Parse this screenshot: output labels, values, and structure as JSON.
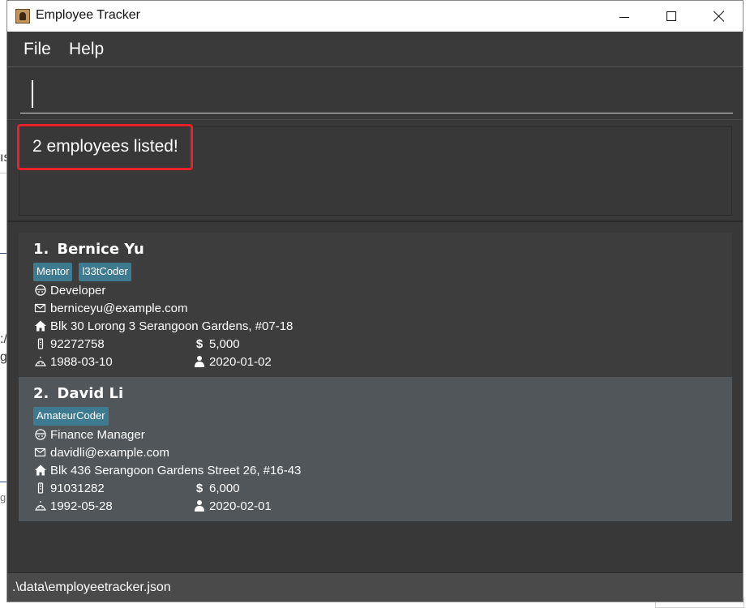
{
  "window": {
    "title": "Employee Tracker"
  },
  "menu": {
    "file_label": "File",
    "help_label": "Help"
  },
  "command": {
    "value": "",
    "placeholder": ""
  },
  "result": {
    "message": "2 employees listed!"
  },
  "employees": [
    {
      "index": "1.",
      "name": "Bernice Yu",
      "tags": [
        "Mentor",
        "l33tCoder"
      ],
      "role": "Developer",
      "email": "berniceyu@example.com",
      "address": "Blk 30 Lorong 3 Serangoon Gardens, #07-18",
      "phone": "92272758",
      "salary": "5,000",
      "birthday": "1988-03-10",
      "start_date": "2020-01-02"
    },
    {
      "index": "2.",
      "name": "David Li",
      "tags": [
        "AmateurCoder"
      ],
      "role": "Finance Manager",
      "email": "davidli@example.com",
      "address": "Blk 436 Serangoon Gardens Street 26, #16-43",
      "phone": "91031282",
      "salary": "6,000",
      "birthday": "1992-05-28",
      "start_date": "2020-02-01"
    }
  ],
  "status": {
    "file_path": ".\\data\\employeetracker.json"
  },
  "colors": {
    "window_bg": "#383838",
    "card_odd": "#3d3d3d",
    "card_even": "#50565a",
    "tag_bg": "#3e7b91",
    "highlight": "#e8212a"
  },
  "background": {
    "frag_1": "ıs",
    "frag_2": ":/",
    "frag_3": "g",
    "frag_4": "g"
  }
}
